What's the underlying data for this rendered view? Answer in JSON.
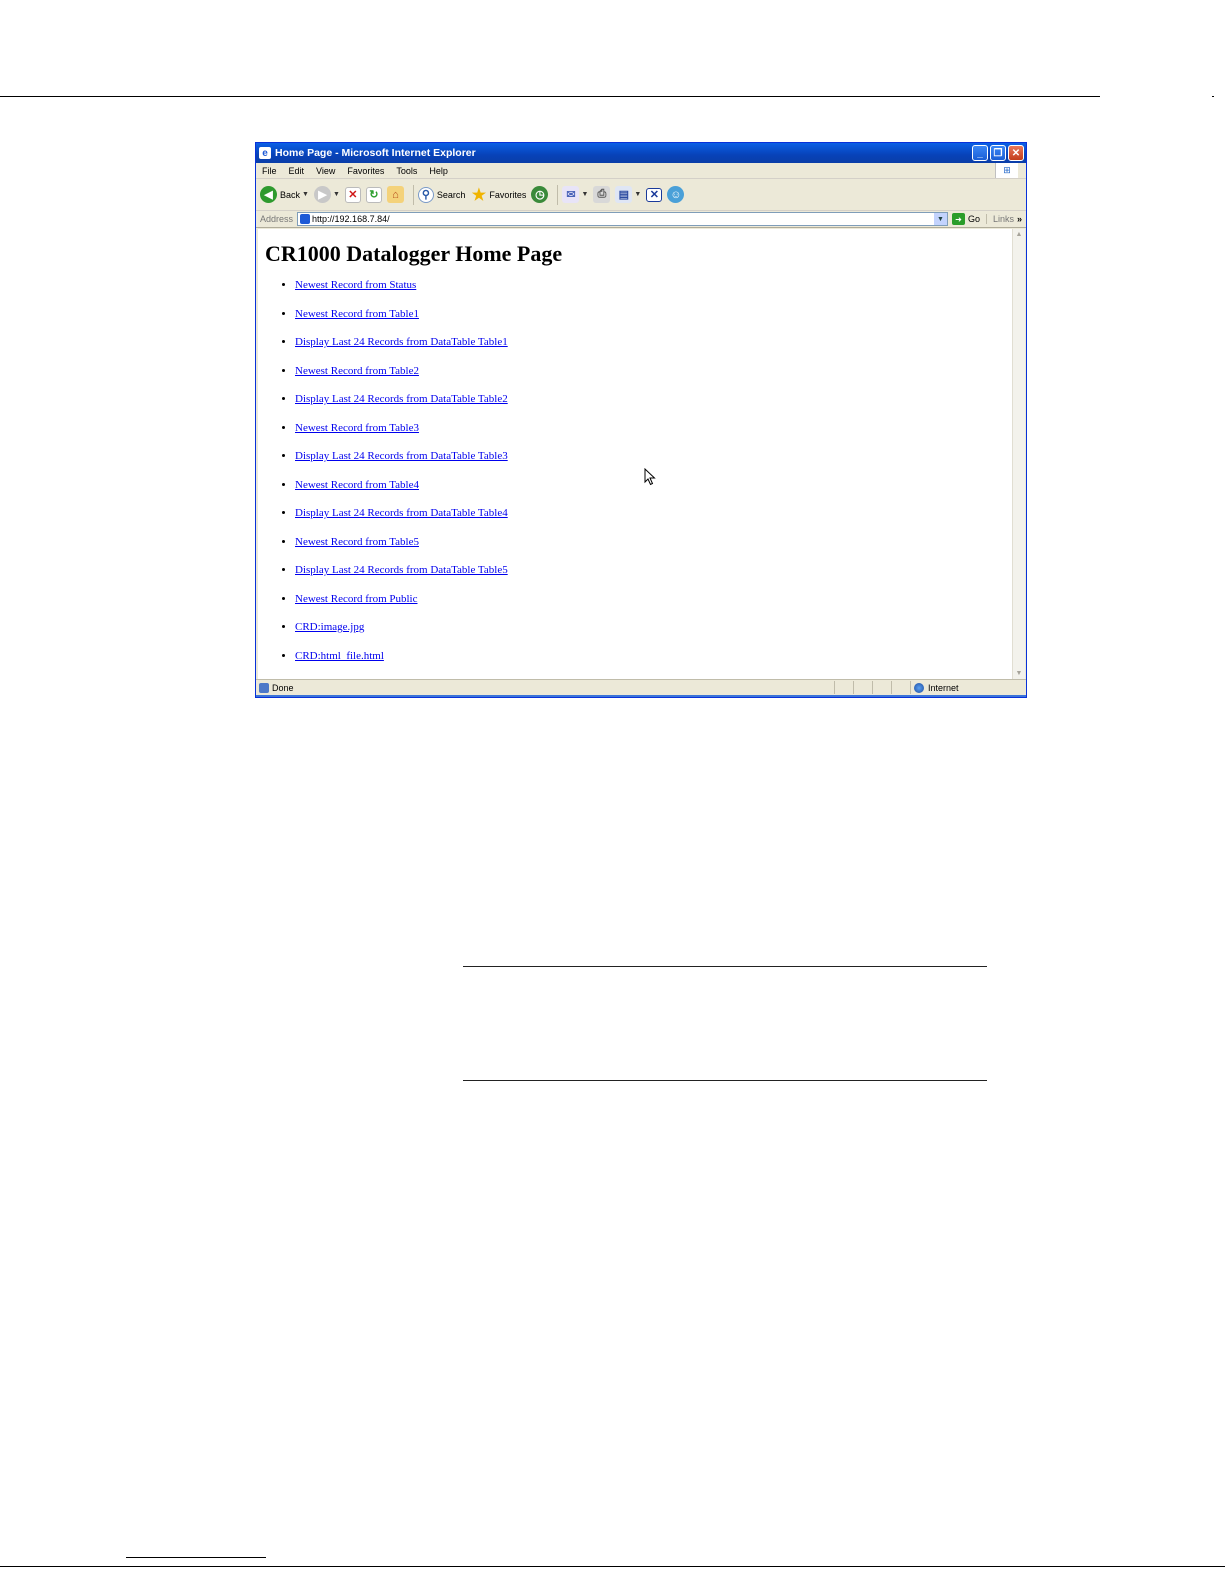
{
  "window": {
    "title": "Home Page - Microsoft Internet Explorer",
    "controls": {
      "minimize": "_",
      "restore": "❐",
      "close": "✕"
    }
  },
  "menu": [
    "File",
    "Edit",
    "View",
    "Favorites",
    "Tools",
    "Help"
  ],
  "toolbar": {
    "back_label": "Back",
    "search_label": "Search",
    "favorites_label": "Favorites",
    "icons": [
      "back-icon",
      "forward-icon",
      "stop-icon",
      "refresh-icon",
      "home-icon",
      "search-icon",
      "favorites-icon",
      "history-icon",
      "mail-icon",
      "print-icon",
      "edit-icon",
      "discuss-icon",
      "messenger-icon"
    ]
  },
  "address": {
    "label": "Address",
    "url": "http://192.168.7.84/",
    "go_label": "Go",
    "links_label": "Links",
    "links_chevron": "»"
  },
  "page": {
    "heading": "CR1000 Datalogger Home Page",
    "links": [
      "Newest Record from Status",
      "Newest Record from Table1",
      "Display Last 24 Records from DataTable Table1",
      "Newest Record from Table2",
      "Display Last 24 Records from DataTable Table2",
      "Newest Record from Table3",
      "Display Last 24 Records from DataTable Table3",
      "Newest Record from Table4",
      "Display Last 24 Records from DataTable Table4",
      "Newest Record from Table5",
      "Display Last 24 Records from DataTable Table5",
      "Newest Record from Public",
      "CRD:image.jpg",
      "CRD:html_file.html"
    ]
  },
  "status": {
    "text": "Done",
    "zone": "Internet"
  },
  "colors": {
    "titlebar": "#0842b8",
    "link": "#0000ee",
    "chrome": "#ece9d8"
  }
}
